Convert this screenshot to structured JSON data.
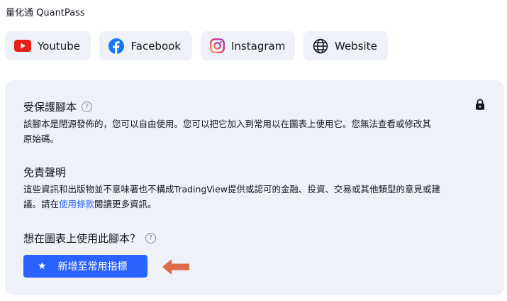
{
  "author": "量化通 QuantPass",
  "social_links": [
    {
      "label": "Youtube",
      "icon": "youtube-icon"
    },
    {
      "label": "Facebook",
      "icon": "facebook-icon"
    },
    {
      "label": "Instagram",
      "icon": "instagram-icon"
    },
    {
      "label": "Website",
      "icon": "globe-icon"
    }
  ],
  "protected": {
    "title": "受保護腳本",
    "line1": "該腳本是閉源發佈的，您可以自由使用。您可以把它加入到常用以在圖表上使用它。您無法查看或修改其",
    "line2": "原始碼。"
  },
  "disclaimer": {
    "title": "免責聲明",
    "line1": "這些資訊和出版物並不意味著也不構成TradingView提供或認可的金融、投資、交易或其他類型的意見或建",
    "line2_before": "議。請在",
    "line2_link": "使用條款",
    "line2_after": "閱讀更多資訊。"
  },
  "use_prompt": "想在圖表上使用此腳本？",
  "add_button": "新增至常用指標",
  "colors": {
    "accent": "#2962ff",
    "arrow": "#e06c47",
    "card_bg": "#eef1f8"
  }
}
